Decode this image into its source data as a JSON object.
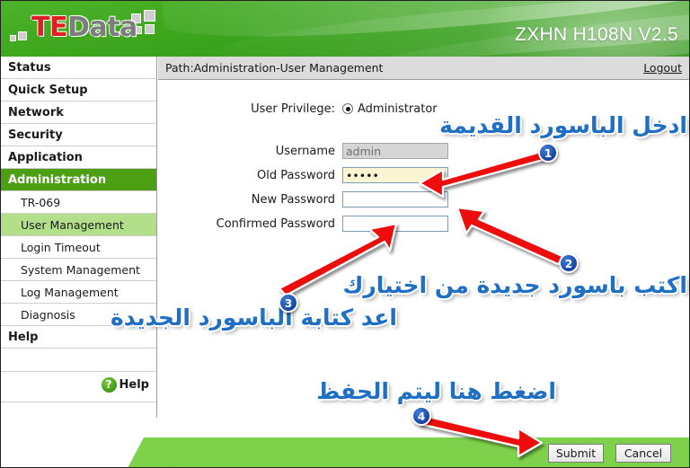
{
  "header": {
    "logo_te": "TE",
    "logo_data": "Data",
    "model_name": "ZXHN H108N V2.5"
  },
  "sidebar": {
    "items": [
      {
        "label": "Status",
        "type": "top",
        "state": "normal"
      },
      {
        "label": "Quick Setup",
        "type": "top",
        "state": "normal"
      },
      {
        "label": "Network",
        "type": "top",
        "state": "normal"
      },
      {
        "label": "Security",
        "type": "top",
        "state": "normal"
      },
      {
        "label": "Application",
        "type": "top",
        "state": "normal"
      },
      {
        "label": "Administration",
        "type": "top",
        "state": "active"
      },
      {
        "label": "TR-069",
        "type": "sub",
        "state": "normal"
      },
      {
        "label": "User Management",
        "type": "sub",
        "state": "selected"
      },
      {
        "label": "Login Timeout",
        "type": "sub",
        "state": "normal"
      },
      {
        "label": "System Management",
        "type": "sub",
        "state": "normal"
      },
      {
        "label": "Log Management",
        "type": "sub",
        "state": "normal"
      },
      {
        "label": "Diagnosis",
        "type": "sub",
        "state": "normal"
      },
      {
        "label": "Help",
        "type": "top",
        "state": "normal"
      }
    ],
    "help_badge": "?",
    "help_label": "Help"
  },
  "pathbar": {
    "path": "Path:Administration-User Management",
    "logout": "Logout"
  },
  "form": {
    "privilege_label": "User Privilege:",
    "privilege_value": "Administrator",
    "username_label": "Username",
    "username_value": "admin",
    "old_password_label": "Old Password",
    "old_password_value": "•••••",
    "new_password_label": "New Password",
    "new_password_value": "",
    "confirmed_password_label": "Confirmed Password",
    "confirmed_password_value": ""
  },
  "footer": {
    "submit_label": "Submit",
    "cancel_label": "Cancel"
  },
  "annotations": [
    {
      "id": "1",
      "text": "ادخل الباسورد القديمة"
    },
    {
      "id": "2",
      "text": "اكتب باسورد جديدة من اختيارك"
    },
    {
      "id": "3",
      "text": "اعد كتابة الباسورد الجديدة"
    },
    {
      "id": "4",
      "text": "اضغط هنا ليتم الحفظ"
    }
  ],
  "colors": {
    "header_green": "#3fa81f",
    "active_nav": "#4c9f13",
    "selected_sub": "#b2e08a",
    "footer_green": "#7ed14b",
    "annotation_blue": "#1f6fc4",
    "arrow_red": "#ee1111",
    "autofill_yellow": "#fbf5d4"
  }
}
